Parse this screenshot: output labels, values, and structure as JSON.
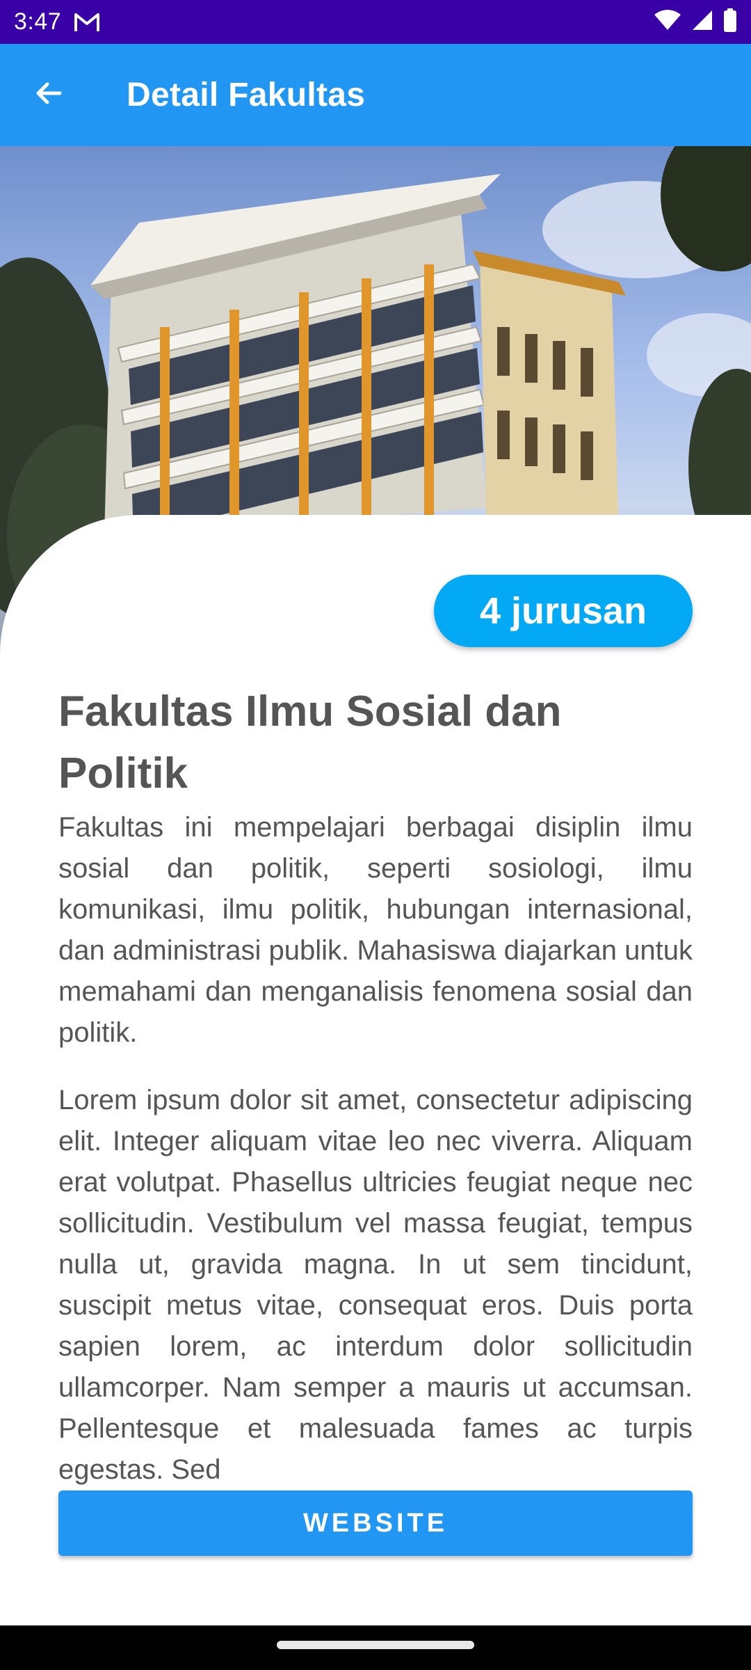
{
  "status_bar": {
    "time": "3:47",
    "icons": [
      "gmail-icon",
      "wifi-icon",
      "signal-icon",
      "battery-icon"
    ]
  },
  "app_bar": {
    "title": "Detail Fakultas",
    "back_icon": "arrow-back-icon",
    "color": "#2196F3"
  },
  "hero_image": {
    "subject": "university-building-photo"
  },
  "detail": {
    "badge": "4 jurusan",
    "title": "Fakultas Ilmu Sosial dan Politik",
    "description": "Fakultas ini mempelajari berbagai disiplin ilmu sosial dan politik, seperti sosiologi, ilmu komunikasi, ilmu politik, hubungan internasional, dan administrasi publik. Mahasiswa diajarkan untuk memahami dan menganalisis fenomena sosial dan politik.",
    "lorem": "Lorem ipsum dolor sit amet, consectetur adipiscing elit. Integer aliquam vitae leo nec viverra. Aliquam erat volutpat. Phasellus ultricies feugiat neque nec sollicitudin. Vestibulum vel massa feugiat, tempus nulla ut, gravida magna. In ut sem tincidunt, suscipit metus vitae, consequat eros. Duis porta sapien lorem, ac interdum dolor sollicitudin ullamcorper. Nam semper a mauris ut accumsan. Pellentesque et malesuada fames ac turpis egestas. Sed",
    "website_button": "WEBSITE"
  },
  "colors": {
    "status_bar": "#3A00A8",
    "accent": "#2196F3",
    "badge": "#03A9F4",
    "text": "#555555"
  }
}
